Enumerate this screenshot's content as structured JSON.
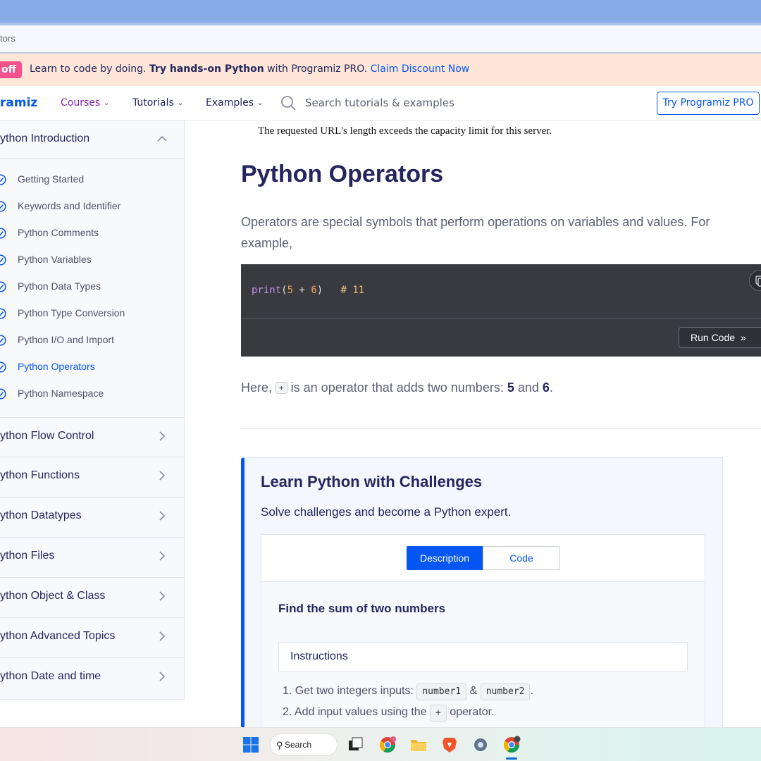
{
  "browser": {
    "url_fragment": "tors"
  },
  "promo": {
    "badge": "off",
    "text_before": "Learn to code by doing. ",
    "text_bold": "Try hands-on Python",
    "text_after": " with Programiz PRO. ",
    "link": "Claim Discount Now"
  },
  "header": {
    "logo": "ramiz",
    "nav": [
      {
        "label": "Courses"
      },
      {
        "label": "Tutorials"
      },
      {
        "label": "Examples"
      }
    ],
    "search_placeholder": "Search tutorials & examples",
    "pro_button": "Try Programiz PRO"
  },
  "sidebar": {
    "intro_section": "ython Introduction",
    "items": [
      {
        "label": "Getting Started"
      },
      {
        "label": "Keywords and Identifier"
      },
      {
        "label": "Python Comments"
      },
      {
        "label": "Python Variables"
      },
      {
        "label": "Python Data Types"
      },
      {
        "label": "Python Type Conversion"
      },
      {
        "label": "Python I/O and Import"
      },
      {
        "label": "Python Operators",
        "active": true
      },
      {
        "label": "Python Namespace"
      }
    ],
    "sections": [
      {
        "label": "ython Flow Control"
      },
      {
        "label": "ython Functions"
      },
      {
        "label": "ython Datatypes"
      },
      {
        "label": "ython Files"
      },
      {
        "label": "ython Object & Class"
      },
      {
        "label": "ython Advanced Topics"
      },
      {
        "label": "ython Date and time"
      }
    ]
  },
  "main": {
    "notice": "The requested URL's length exceeds the capacity limit for this server.",
    "title": "Python Operators",
    "intro": "Operators are special symbols that perform operations on variables and values. For example,",
    "code": {
      "fn": "print",
      "open": "(",
      "a": "5",
      "op": " + ",
      "b": "6",
      "close": ")",
      "gap": "   ",
      "comment": "# 11"
    },
    "run_button": "Run Code",
    "here": {
      "prefix": "Here, ",
      "kbd": "+",
      "middle": " is an operator that adds two numbers: ",
      "n1": "5",
      "and": " and ",
      "n2": "6",
      "end": "."
    }
  },
  "challenge": {
    "title": "Learn Python with Challenges",
    "subtitle": "Solve challenges and become a Python expert.",
    "tabs": [
      {
        "label": "Description",
        "active": true
      },
      {
        "label": "Code"
      }
    ],
    "task_title": "Find the sum of two numbers",
    "instructions_label": "Instructions",
    "steps": {
      "s1_prefix": "1. Get two integers inputs: ",
      "s1_code1": "number1",
      "s1_amp": " & ",
      "s1_code2": "number2",
      "s1_end": ".",
      "s2_prefix": "2. Add input values using the ",
      "s2_code": "+",
      "s2_end": " operator."
    }
  },
  "taskbar": {
    "search_label": "Search"
  },
  "colors": {
    "accent": "#0556f3",
    "text": "#25265e",
    "promo_bg": "#fde6d8",
    "badge": "#f5528b",
    "code_bg": "#383a40"
  }
}
